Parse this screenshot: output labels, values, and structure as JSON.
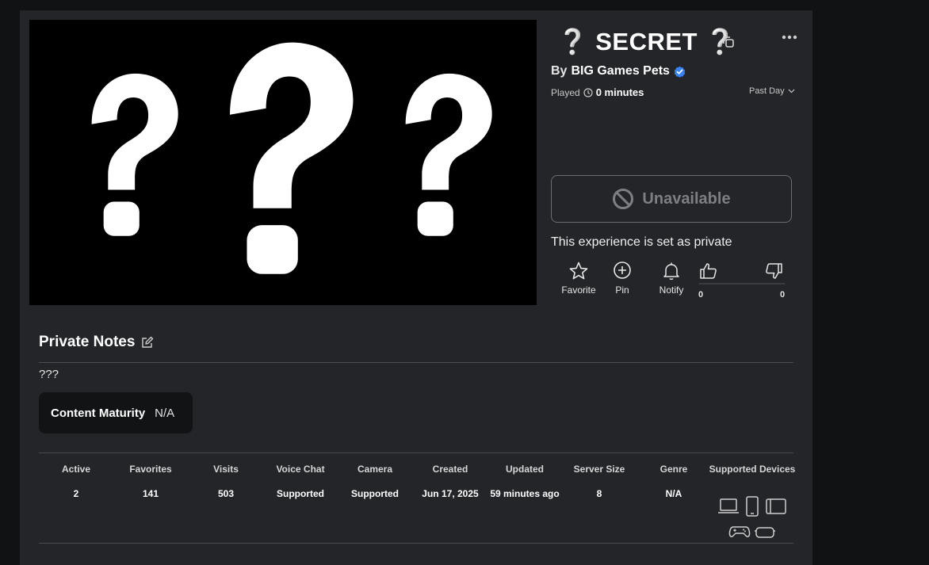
{
  "game": {
    "title": "SECRET",
    "title_prefix": "❔",
    "title_suffix": "❔",
    "by_prefix": "By",
    "creator": "BIG Games Pets",
    "played_label": "Played",
    "played_value": "0 minutes",
    "period": "Past Day",
    "play_button_label": "Unavailable",
    "private_message": "This experience is set as private"
  },
  "actions": {
    "favorite": "Favorite",
    "pin": "Pin",
    "notify": "Notify",
    "upvotes": "0",
    "downvotes": "0"
  },
  "notes": {
    "title": "Private Notes",
    "text": "???"
  },
  "maturity": {
    "label": "Content Maturity",
    "value": "N/A"
  },
  "stats": [
    {
      "label": "Active",
      "value": "2"
    },
    {
      "label": "Favorites",
      "value": "141"
    },
    {
      "label": "Visits",
      "value": "503"
    },
    {
      "label": "Voice Chat",
      "value": "Supported"
    },
    {
      "label": "Camera",
      "value": "Supported"
    },
    {
      "label": "Created",
      "value": "Jun 17, 2025"
    },
    {
      "label": "Updated",
      "value": "59 minutes ago"
    },
    {
      "label": "Server Size",
      "value": "8"
    },
    {
      "label": "Genre",
      "value": "N/A"
    },
    {
      "label": "Supported Devices",
      "value": ""
    }
  ],
  "devices": [
    "computer-icon",
    "phone-icon",
    "tablet-icon",
    "console-icon",
    "vr-icon"
  ],
  "colors": {
    "background": "#111214",
    "panel": "#232529",
    "verified": "#3b82f6"
  }
}
